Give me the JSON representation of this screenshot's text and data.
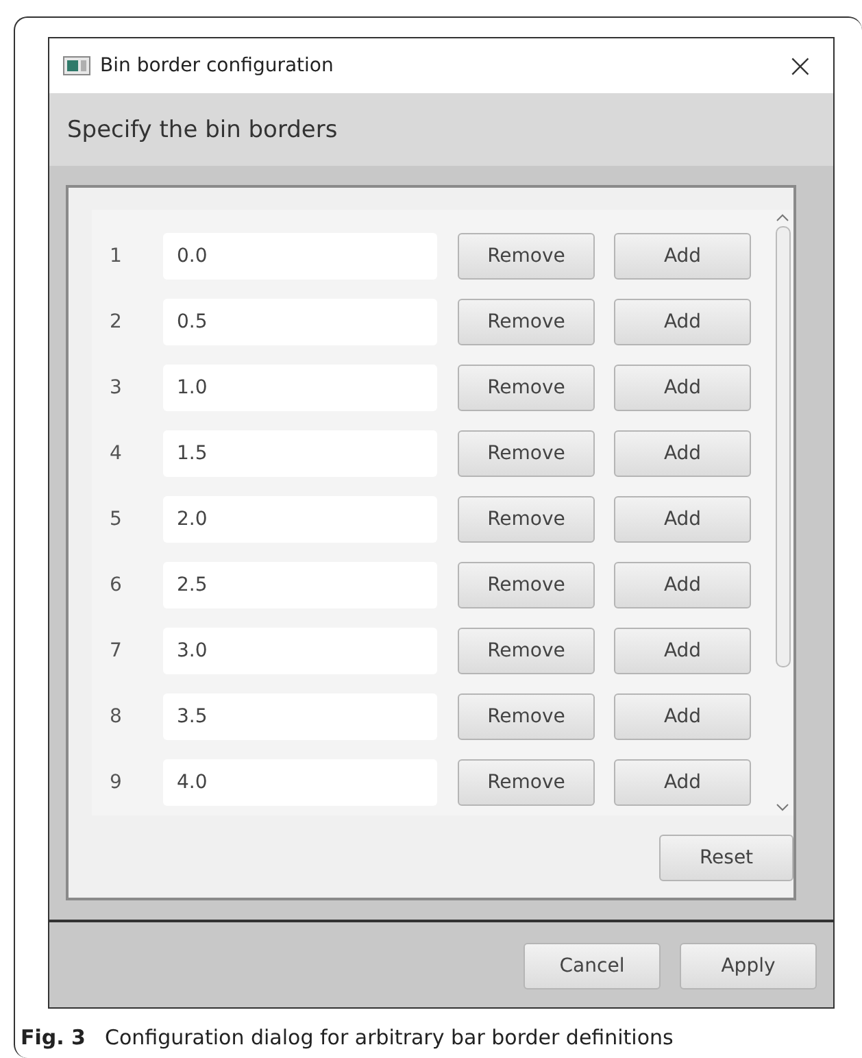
{
  "window": {
    "title": "Bin border configuration",
    "close": "×"
  },
  "header": "Specify the bin borders",
  "rows": [
    {
      "index": "1",
      "value": "0.0",
      "remove": "Remove",
      "add": "Add"
    },
    {
      "index": "2",
      "value": "0.5",
      "remove": "Remove",
      "add": "Add"
    },
    {
      "index": "3",
      "value": "1.0",
      "remove": "Remove",
      "add": "Add"
    },
    {
      "index": "4",
      "value": "1.5",
      "remove": "Remove",
      "add": "Add"
    },
    {
      "index": "5",
      "value": "2.0",
      "remove": "Remove",
      "add": "Add"
    },
    {
      "index": "6",
      "value": "2.5",
      "remove": "Remove",
      "add": "Add"
    },
    {
      "index": "7",
      "value": "3.0",
      "remove": "Remove",
      "add": "Add"
    },
    {
      "index": "8",
      "value": "3.5",
      "remove": "Remove",
      "add": "Add"
    },
    {
      "index": "9",
      "value": "4.0",
      "remove": "Remove",
      "add": "Add"
    }
  ],
  "reset": "Reset",
  "buttons": [
    "Cancel",
    "Apply"
  ],
  "caption": {
    "label": "Fig. 3",
    "text": "Configuration dialog for arbitrary bar border definitions"
  }
}
